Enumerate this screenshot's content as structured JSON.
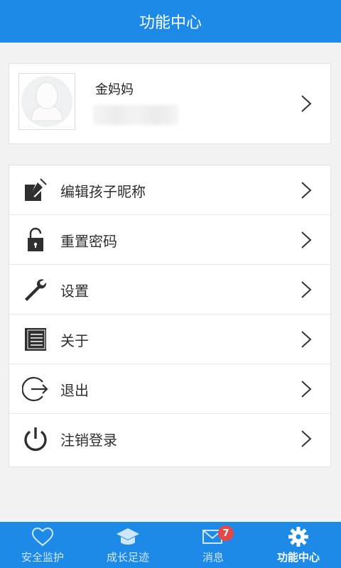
{
  "header": {
    "title": "功能中心"
  },
  "profile": {
    "name": "金妈妈"
  },
  "menu": {
    "items": [
      {
        "label": "编辑孩子昵称",
        "icon": "edit-icon"
      },
      {
        "label": "重置密码",
        "icon": "lock-icon"
      },
      {
        "label": "设置",
        "icon": "wrench-icon"
      },
      {
        "label": "关于",
        "icon": "book-icon"
      },
      {
        "label": "退出",
        "icon": "exit-icon"
      },
      {
        "label": "注销登录",
        "icon": "power-icon"
      }
    ]
  },
  "tabs": [
    {
      "label": "安全监护",
      "icon": "heart-icon"
    },
    {
      "label": "成长足迹",
      "icon": "graduation-cap-icon"
    },
    {
      "label": "消息",
      "icon": "mail-icon",
      "badge": "7"
    },
    {
      "label": "功能中心",
      "icon": "gear-icon",
      "active": true
    }
  ],
  "colors": {
    "primary": "#1e8ae8",
    "badge": "#e24a4a"
  }
}
